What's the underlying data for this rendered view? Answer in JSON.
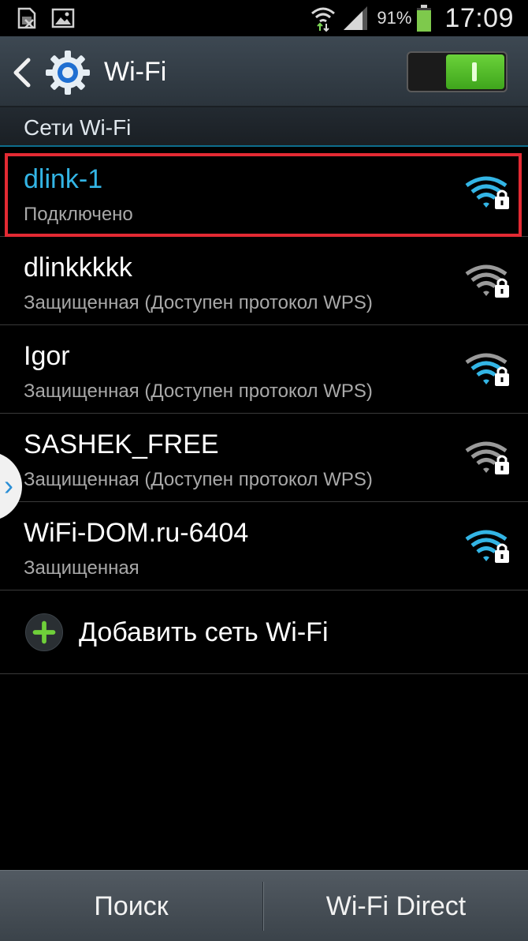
{
  "status_bar": {
    "left_icons": [
      "no-sim-icon",
      "gallery-icon"
    ],
    "right_icons": [
      "wifi-transfer-icon",
      "signal-icon",
      "battery-icon"
    ],
    "battery_percent": "91%",
    "time": "17:09"
  },
  "action_bar": {
    "back_icon": "chevron-left-icon",
    "settings_icon": "gear-icon",
    "title": "Wi-Fi",
    "toggle_state": "on",
    "accent_color": "#6bd23a"
  },
  "section": {
    "title": "Сети Wi-Fi"
  },
  "networks": [
    {
      "name": "dlink-1",
      "status": "Подключено",
      "connected": true,
      "signal_color": "#33b5e5",
      "locked": true
    },
    {
      "name": "dlinkkkkk",
      "status": "Защищенная (Доступен протокол WPS)",
      "connected": false,
      "signal_color": "#9a9a9a",
      "locked": true
    },
    {
      "name": "Igor",
      "status": "Защищенная (Доступен протокол WPS)",
      "connected": false,
      "signal_color": "#33b5e5",
      "locked": true
    },
    {
      "name": "SASHEK_FREE",
      "status": "Защищенная (Доступен протокол WPS)",
      "connected": false,
      "signal_color": "#9a9a9a",
      "locked": true
    },
    {
      "name": "WiFi-DOM.ru-6404",
      "status": "Защищенная",
      "connected": false,
      "signal_color": "#33b5e5",
      "locked": true
    }
  ],
  "add_network": {
    "label": "Добавить сеть Wi-Fi",
    "icon": "plus-icon"
  },
  "bottom_bar": {
    "search_label": "Поиск",
    "direct_label": "Wi-Fi Direct"
  },
  "colors": {
    "connected_text": "#33b5e5",
    "highlight": "#e32a33"
  }
}
